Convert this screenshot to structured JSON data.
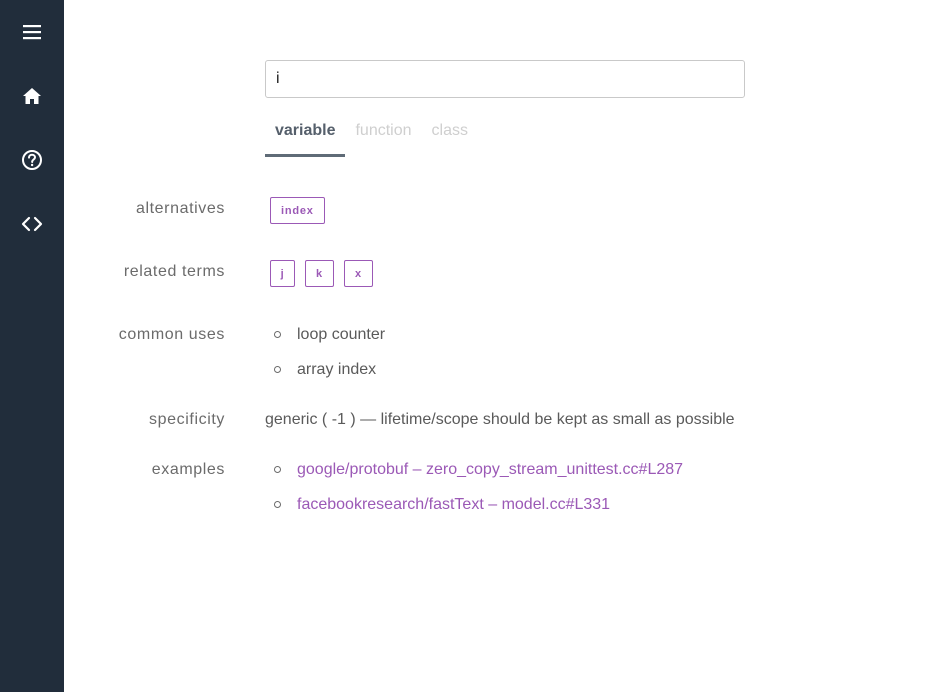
{
  "sidebar": {
    "items": [
      {
        "icon": "menu-icon"
      },
      {
        "icon": "home-icon"
      },
      {
        "icon": "help-icon"
      },
      {
        "icon": "code-icon"
      }
    ]
  },
  "search": {
    "value": "i"
  },
  "tabs": [
    {
      "label": "variable",
      "active": true
    },
    {
      "label": "function",
      "active": false
    },
    {
      "label": "class",
      "active": false
    }
  ],
  "sections": {
    "alternatives": {
      "label": "alternatives",
      "chips": [
        "index"
      ]
    },
    "related_terms": {
      "label": "related terms",
      "chips": [
        "j",
        "k",
        "x"
      ]
    },
    "common_uses": {
      "label": "common uses",
      "items": [
        "loop counter",
        "array index"
      ]
    },
    "specificity": {
      "label": "specificity",
      "prefix": "generic (",
      "value": " -1 ",
      "suffix": ") — lifetime/scope should be kept as small as possible"
    },
    "examples": {
      "label": "examples",
      "items": [
        {
          "repo": "google/protobuf",
          "sep": " – ",
          "file": "zero_copy_stream_unittest.cc#L287"
        },
        {
          "repo": "facebookresearch/fastText",
          "sep": " – ",
          "file": "model.cc#L331"
        }
      ]
    }
  },
  "colors": {
    "sidebar_bg": "#212d3b",
    "accent": "#9b59b6",
    "label_text": "#6b6b6b"
  }
}
